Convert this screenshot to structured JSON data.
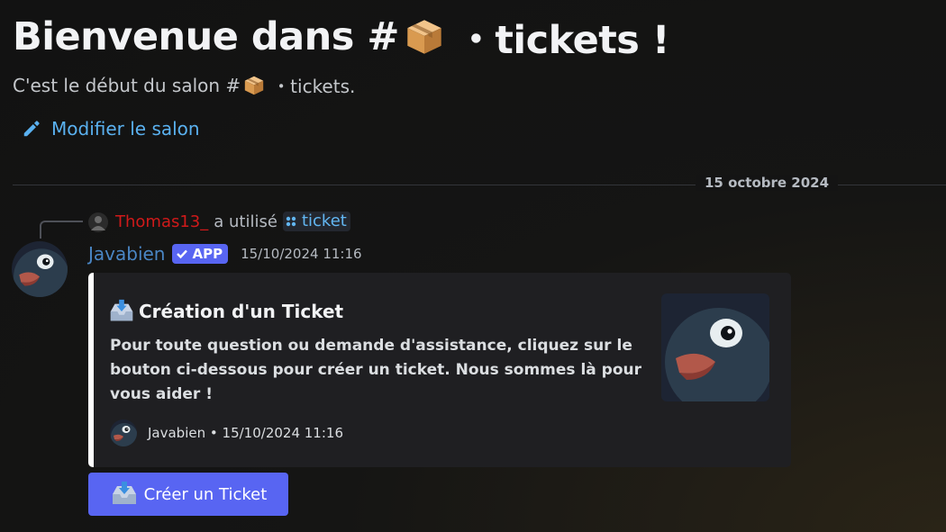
{
  "welcome": {
    "title_prefix": "Bienvenue dans #",
    "title_suffix": "・tickets !",
    "subtitle_prefix": "C'est le début du salon #",
    "subtitle_suffix": "・tickets.",
    "edit_label": "Modifier le salon",
    "channel_icon": "package-emoji"
  },
  "divider": {
    "date": "15 octobre 2024"
  },
  "reply": {
    "user": "Thomas13_",
    "action": "a utilisé",
    "command": "ticket"
  },
  "message": {
    "author": "Javabien",
    "badge": "APP",
    "timestamp": "15/10/2024 11:16"
  },
  "embed": {
    "title": "Création d'un Ticket",
    "title_icon": "inbox-tray-emoji",
    "description": "Pour toute question ou demande d'assistance, cliquez sur le bouton ci-dessous pour créer un ticket. Nous sommes là pour vous aider !",
    "footer_author": "Javabien",
    "footer_separator": "•",
    "footer_time": "15/10/2024 11:16"
  },
  "button": {
    "label": "Créer un Ticket",
    "icon": "inbox-tray-emoji"
  },
  "colors": {
    "accent": "#5865f2",
    "link": "#5ab1f0",
    "reply_user": "#d01a1a",
    "author": "#4a86c4",
    "embed_border": "#ffffff"
  }
}
